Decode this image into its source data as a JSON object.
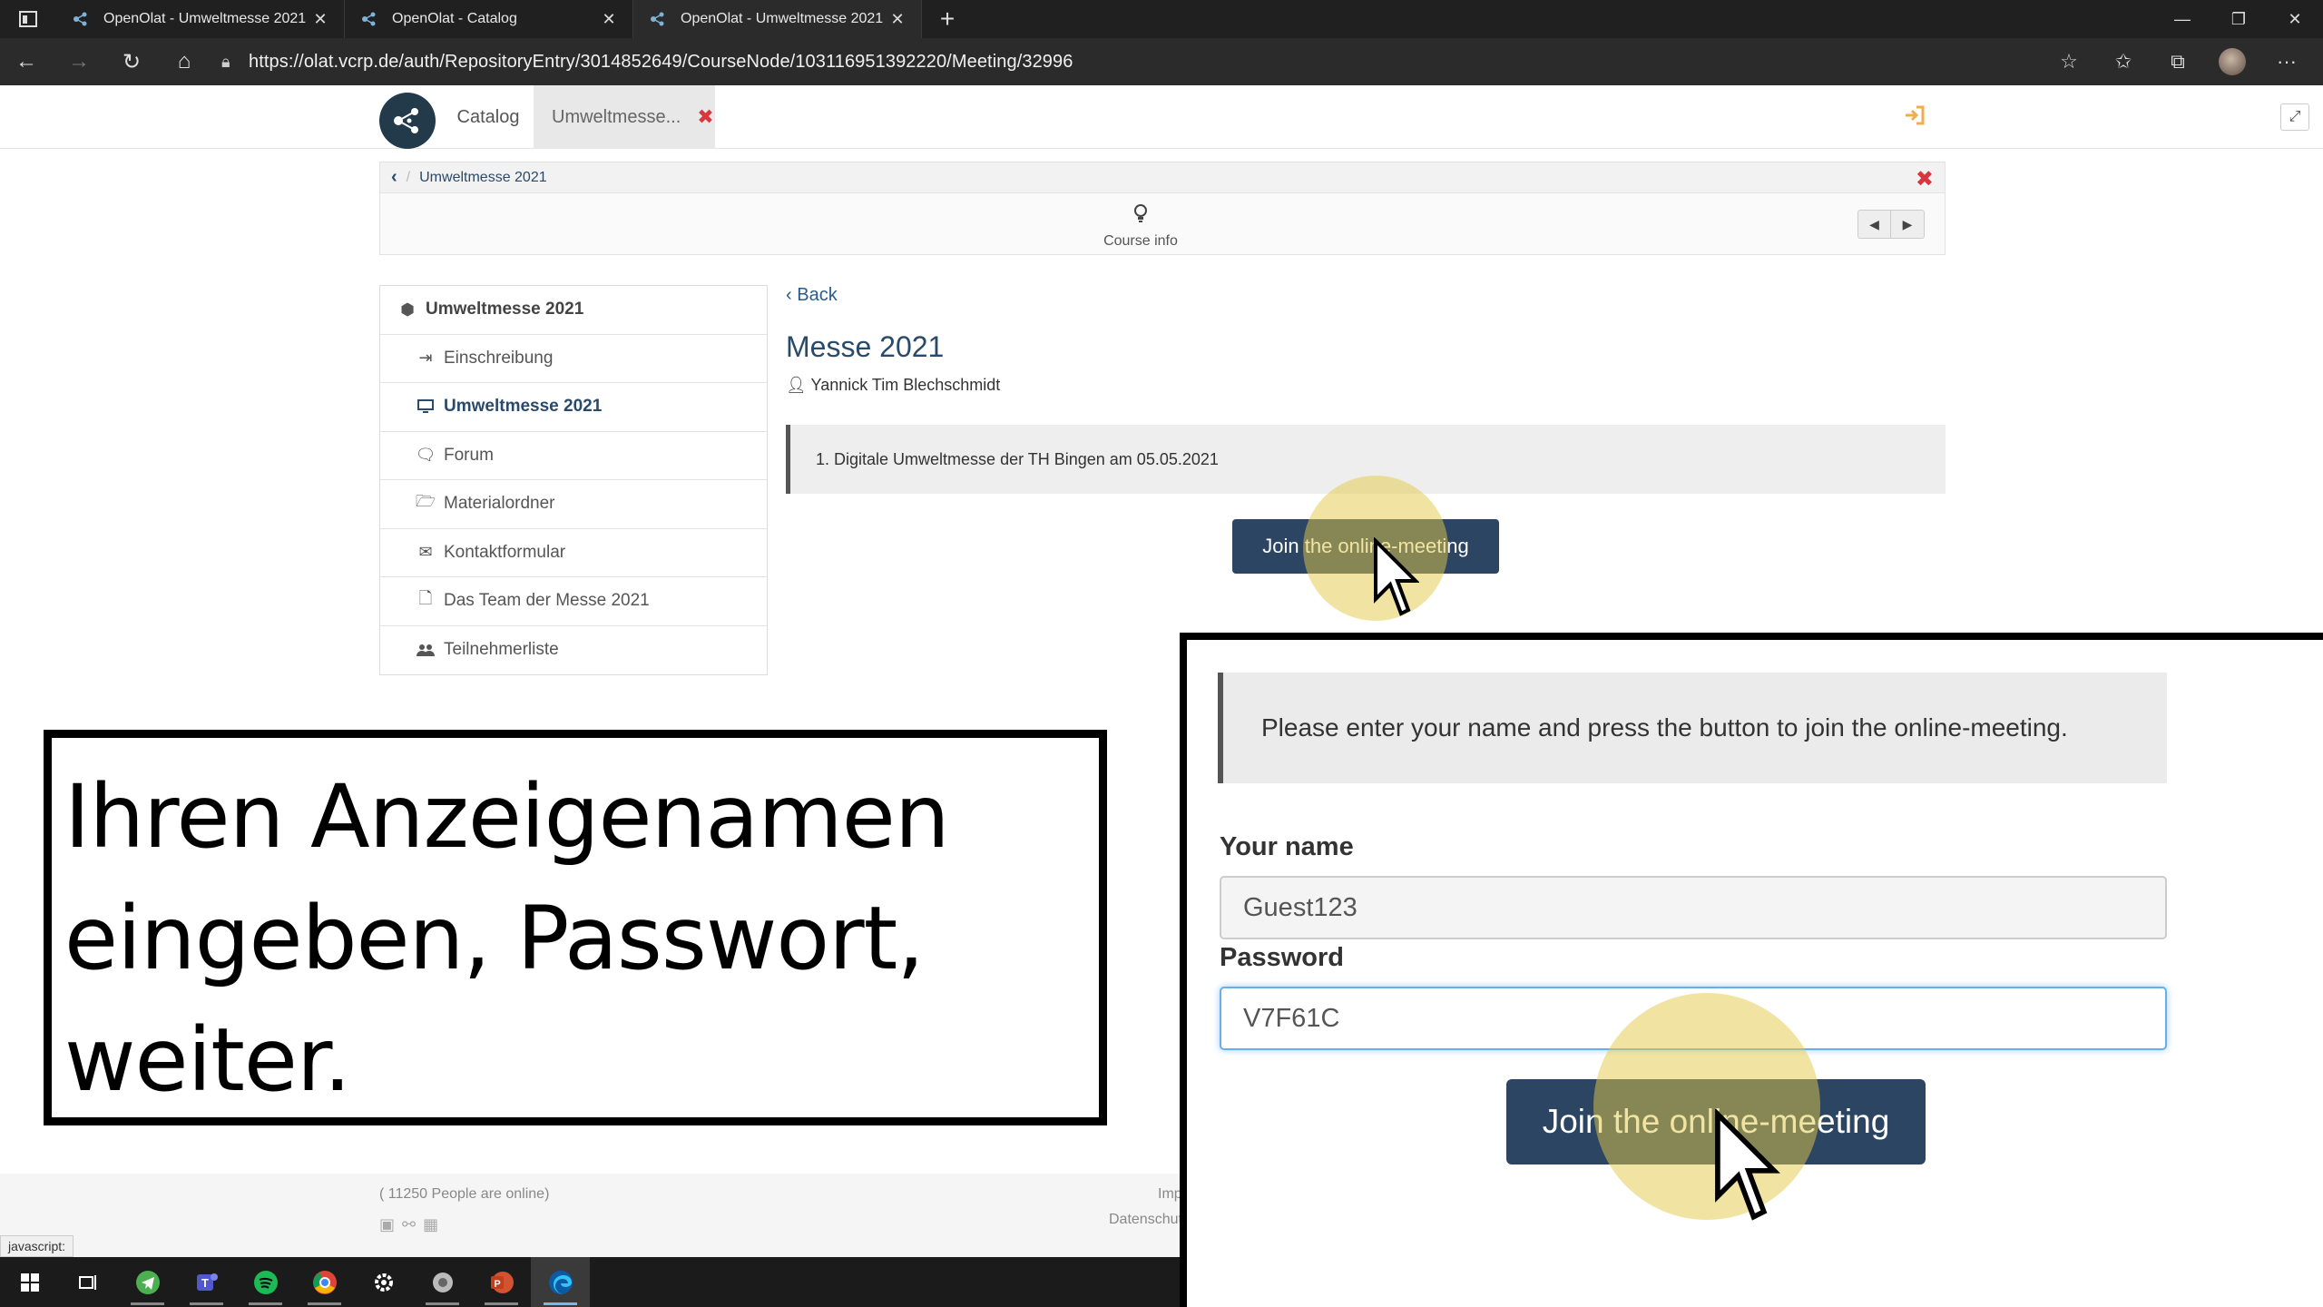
{
  "browser": {
    "tabs": [
      {
        "title": "OpenOlat - Umweltmesse 2021",
        "active": false
      },
      {
        "title": "OpenOlat - Catalog",
        "active": false
      },
      {
        "title": "OpenOlat - Umweltmesse 2021",
        "active": true
      }
    ],
    "url": "https://olat.vcrp.de/auth/RepositoryEntry/3014852649/CourseNode/103116951392220/Meeting/32996"
  },
  "header": {
    "nav_catalog": "Catalog",
    "nav_course": "Umweltmesse...",
    "close_glyph": "✖"
  },
  "course_bar": {
    "breadcrumb": "Umweltmesse 2021",
    "course_info": "Course info"
  },
  "menu": {
    "root": "Umweltmesse 2021",
    "items": [
      {
        "label": "Einschreibung",
        "icon": "sign-in-icon"
      },
      {
        "label": "Umweltmesse 2021",
        "icon": "monitor-icon",
        "active": true
      },
      {
        "label": "Forum",
        "icon": "comments-icon"
      },
      {
        "label": "Materialordner",
        "icon": "folder-open-icon"
      },
      {
        "label": "Kontaktformular",
        "icon": "envelope-icon"
      },
      {
        "label": "Das Team der Messe 2021",
        "icon": "file-icon"
      },
      {
        "label": "Teilnehmerliste",
        "icon": "users-icon"
      }
    ]
  },
  "main": {
    "back": "Back",
    "title": "Messe 2021",
    "author": "Yannick Tim Blechschmidt",
    "description": "1. Digitale Umweltmesse der TH Bingen am 05.05.2021",
    "join_button": "Join the online-meeting"
  },
  "footer": {
    "online": "( 11250 People are online)",
    "imprint": "Imp",
    "privacy": "Datenschut"
  },
  "status_bar": "javascript:",
  "annotation": {
    "line1": "Ihren Anzeigenamen",
    "line2": "eingeben, Passwort,",
    "line3": "weiter."
  },
  "zoom": {
    "info": "Please enter your name and press the button to join the online-meeting.",
    "name_label": "Your name",
    "name_value": "Guest123",
    "password_label": "Password",
    "password_value": "V7F61C",
    "join_button": "Join the online-meeting"
  },
  "colors": {
    "primary_button": "#2b4563",
    "link": "#2a4a6b",
    "close_red": "#d9363e",
    "highlight": "#e4c948"
  }
}
